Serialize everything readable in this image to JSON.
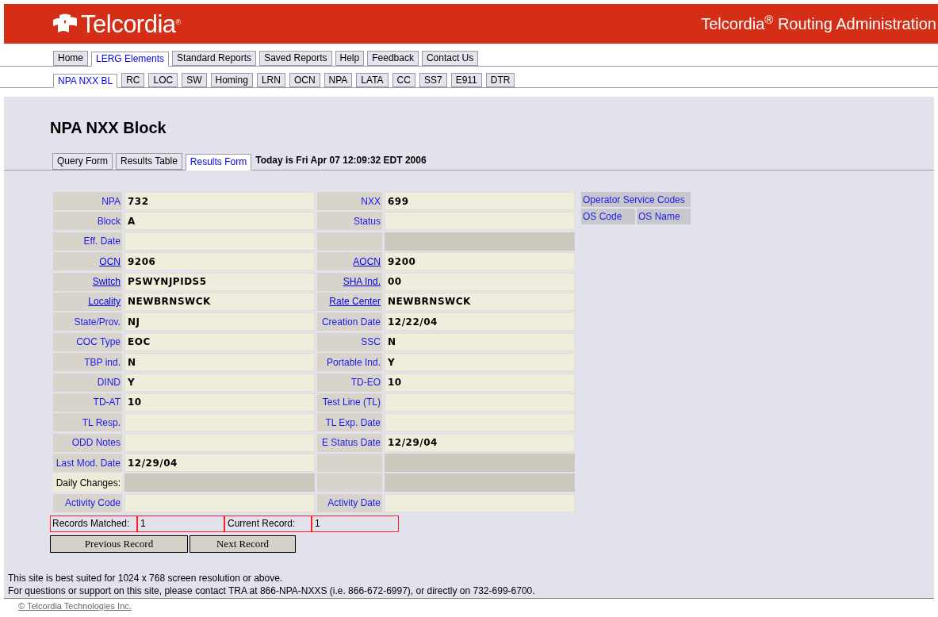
{
  "header": {
    "logo_text": "Telcordia",
    "logo_mark": "®",
    "title": "Telcordia$^{®}$ Routing Administration"
  },
  "main_nav": [
    {
      "label": "Home",
      "selected": false
    },
    {
      "label": "LERG Elements",
      "selected": true
    },
    {
      "label": "Standard Reports",
      "selected": false
    },
    {
      "label": "Saved Reports",
      "selected": false
    },
    {
      "label": "Help",
      "selected": false
    },
    {
      "label": "Feedback",
      "selected": false
    },
    {
      "label": "Contact Us",
      "selected": false
    }
  ],
  "sub_nav": [
    {
      "label": "NPA NXX BL",
      "selected": true
    },
    {
      "label": "RC",
      "selected": false
    },
    {
      "label": "LOC",
      "selected": false
    },
    {
      "label": "SW",
      "selected": false
    },
    {
      "label": "Homing",
      "selected": false
    },
    {
      "label": "LRN",
      "selected": false
    },
    {
      "label": "OCN",
      "selected": false
    },
    {
      "label": "NPA",
      "selected": false
    },
    {
      "label": "LATA",
      "selected": false
    },
    {
      "label": "CC",
      "selected": false
    },
    {
      "label": "SS7",
      "selected": false
    },
    {
      "label": "E911",
      "selected": false
    },
    {
      "label": "DTR",
      "selected": false
    }
  ],
  "page_title": "NPA NXX Block",
  "view_tabs": [
    {
      "label": "Query Form",
      "selected": false
    },
    {
      "label": "Results Table",
      "selected": false
    },
    {
      "label": "Results Form",
      "selected": true
    }
  ],
  "today": "Today is Fri Apr 07 12:09:32 EDT 2006",
  "rows": [
    {
      "left": {
        "label": "NPA",
        "kind": "text",
        "value": "732",
        "shaded": false
      },
      "right": {
        "label": "NXX",
        "kind": "text",
        "value": "699",
        "shaded": false
      }
    },
    {
      "left": {
        "label": "Block",
        "kind": "text",
        "value": "A",
        "shaded": false
      },
      "right": {
        "label": "Status",
        "kind": "text",
        "shaded": false
      }
    },
    {
      "left": {
        "label": "Eff. Date",
        "kind": "text",
        "shaded": false
      },
      "right": {
        "kind": "blank",
        "shaded": true
      }
    },
    {
      "left": {
        "label": "OCN",
        "kind": "link",
        "value": "9206",
        "shaded": false
      },
      "right": {
        "label": "AOCN",
        "kind": "link",
        "value": "9200",
        "shaded": false
      }
    },
    {
      "left": {
        "label": "Switch",
        "kind": "link",
        "value": "PSWYNJPIDS5",
        "shaded": false
      },
      "right": {
        "label": "SHA Ind.",
        "kind": "link",
        "value": "00",
        "shaded": false
      }
    },
    {
      "left": {
        "label": "Locality",
        "kind": "link",
        "value": "NEWBRNSWCK",
        "shaded": false
      },
      "right": {
        "label": "Rate Center",
        "kind": "link",
        "value": "NEWBRNSWCK",
        "shaded": false
      }
    },
    {
      "left": {
        "label": "State/Prov.",
        "kind": "text",
        "value": "NJ",
        "shaded": false
      },
      "right": {
        "label": "Creation Date",
        "kind": "text",
        "value": "12/22/04",
        "shaded": false
      }
    },
    {
      "left": {
        "label": "COC Type",
        "kind": "text",
        "value": "EOC",
        "shaded": false
      },
      "right": {
        "label": "SSC",
        "kind": "text",
        "value": "N",
        "shaded": false
      }
    },
    {
      "left": {
        "label": "TBP ind.",
        "kind": "text",
        "value": "N",
        "shaded": false
      },
      "right": {
        "label": "Portable Ind.",
        "kind": "text",
        "value": "Y",
        "shaded": false
      }
    },
    {
      "left": {
        "label": "DIND",
        "kind": "text",
        "value": "Y",
        "shaded": false
      },
      "right": {
        "label": "TD-EO",
        "kind": "text",
        "value": "10",
        "shaded": false
      }
    },
    {
      "left": {
        "label": "TD-AT",
        "kind": "text",
        "value": "10",
        "shaded": false
      },
      "right": {
        "label": "Test Line (TL)",
        "kind": "text",
        "shaded": false
      }
    },
    {
      "left": {
        "label": "TL Resp.",
        "kind": "text",
        "shaded": false
      },
      "right": {
        "label": "TL Exp. Date",
        "kind": "text",
        "shaded": false
      }
    },
    {
      "left": {
        "label": "ODD Notes",
        "kind": "text",
        "shaded": false
      },
      "right": {
        "label": "E Status Date",
        "kind": "text",
        "value": "12/29/04",
        "shaded": false
      }
    },
    {
      "left": {
        "label": "Last Mod. Date",
        "kind": "text",
        "value": "12/29/04",
        "shaded": false
      },
      "right": {
        "kind": "blank",
        "shaded": true
      }
    },
    {
      "left": {
        "label": "Daily Changes:",
        "kind": "note",
        "shaded": true
      },
      "right": {
        "kind": "blank",
        "shaded": true
      }
    },
    {
      "left": {
        "label": "Activity Code",
        "kind": "text",
        "shaded": false
      },
      "right": {
        "label": "Activity Date",
        "kind": "text",
        "shaded": false
      }
    }
  ],
  "os_panel": {
    "title": "Operator Service Codes",
    "columns": [
      "OS Code",
      "OS Name"
    ]
  },
  "records": {
    "matched_label": "Records Matched:",
    "matched": "1",
    "current_label": "Current Record:",
    "current": "1"
  },
  "buttons": [
    "Previous Record",
    "Next Record"
  ],
  "footer": {
    "lines": [
      "This site is best suited for 1024 x 768 screen resolution or above.",
      "For questions or support on this site, please contact TRA at 866-NPA-NXXS (i.e. 866-672-6997), or directly on 732-699-6700."
    ],
    "copyright": "© Telcordia Technologies Inc."
  }
}
